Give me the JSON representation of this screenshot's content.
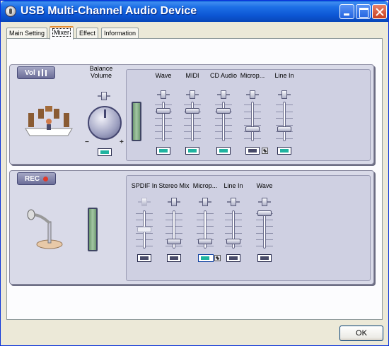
{
  "window": {
    "title": "USB Multi-Channel Audio Device"
  },
  "tabs": [
    "Main Setting",
    "Mixer",
    "Effect",
    "Information"
  ],
  "active_tab": "Mixer",
  "volume": {
    "label": "Vol",
    "balance_label_line1": "Balance",
    "balance_label_line2": "Volume",
    "minus": "−",
    "plus": "+",
    "balance_mute": false,
    "channels": [
      {
        "name": "Wave",
        "level": 0.18,
        "muted": false,
        "enabled": true
      },
      {
        "name": "MIDI",
        "level": 0.18,
        "muted": false,
        "enabled": true
      },
      {
        "name": "CD Audio",
        "level": 0.18,
        "muted": false,
        "enabled": true
      },
      {
        "name": "Microp...",
        "level": 0.72,
        "muted": true,
        "enabled": true
      },
      {
        "name": "Line In",
        "level": 0.72,
        "muted": false,
        "enabled": true
      }
    ]
  },
  "recording": {
    "label": "REC",
    "channels": [
      {
        "name": "SPDIF In",
        "level": 0.5,
        "selected": false,
        "enabled": false
      },
      {
        "name": "Stereo Mix",
        "level": 0.86,
        "selected": false,
        "enabled": true
      },
      {
        "name": "Microp...",
        "level": 0.86,
        "selected": true,
        "enabled": true
      },
      {
        "name": "Line In",
        "level": 0.86,
        "selected": false,
        "enabled": true
      },
      {
        "name": "Wave",
        "level": 0.0,
        "selected": false,
        "enabled": true
      }
    ]
  },
  "buttons": {
    "ok": "OK"
  },
  "colors": {
    "title_bar": "#0c56d4",
    "panel": "#d9dae8",
    "accent_teal": "#20b3a0",
    "rec_dot": "#e03a2a"
  }
}
